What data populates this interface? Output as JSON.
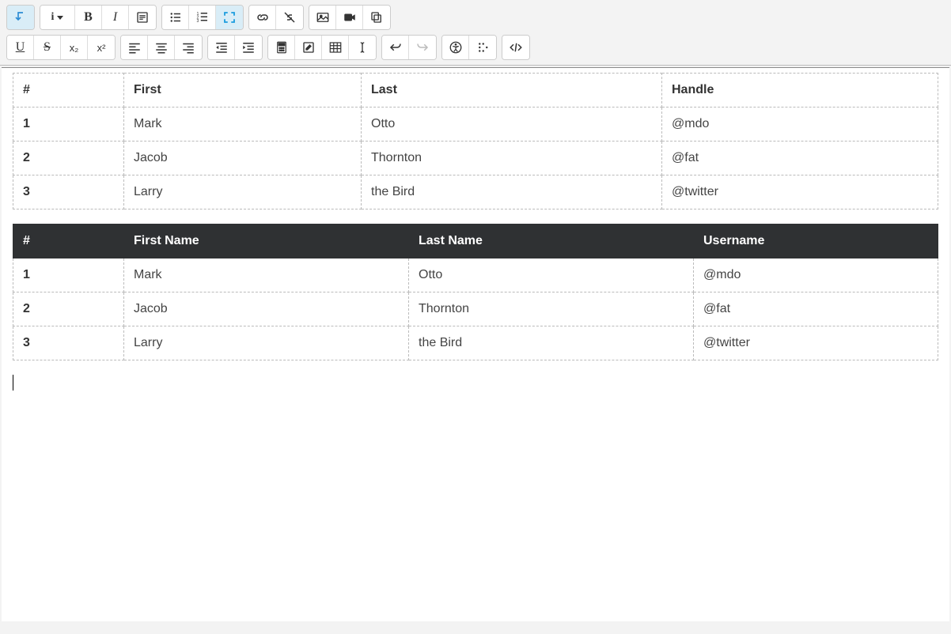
{
  "toolbar": {
    "row1": {
      "toggle": "↧",
      "formats": "i",
      "bold": "B",
      "italic": "I"
    },
    "row2": {
      "sub": "x₂",
      "sup": "x²"
    }
  },
  "table1": {
    "headers": {
      "num": "#",
      "first": "First",
      "last": "Last",
      "handle": "Handle"
    },
    "rows": [
      {
        "num": "1",
        "first": "Mark",
        "last": "Otto",
        "handle": "@mdo"
      },
      {
        "num": "2",
        "first": "Jacob",
        "last": "Thornton",
        "handle": "@fat"
      },
      {
        "num": "3",
        "first": "Larry",
        "last": "the Bird",
        "handle": "@twitter"
      }
    ]
  },
  "table2": {
    "headers": {
      "num": "#",
      "first": "First Name",
      "last": "Last Name",
      "user": "Username"
    },
    "rows": [
      {
        "num": "1",
        "first": "Mark",
        "last": "Otto",
        "user": "@mdo"
      },
      {
        "num": "2",
        "first": "Jacob",
        "last": "Thornton",
        "user": "@fat"
      },
      {
        "num": "3",
        "first": "Larry",
        "last": "the Bird",
        "user": "@twitter"
      }
    ]
  }
}
